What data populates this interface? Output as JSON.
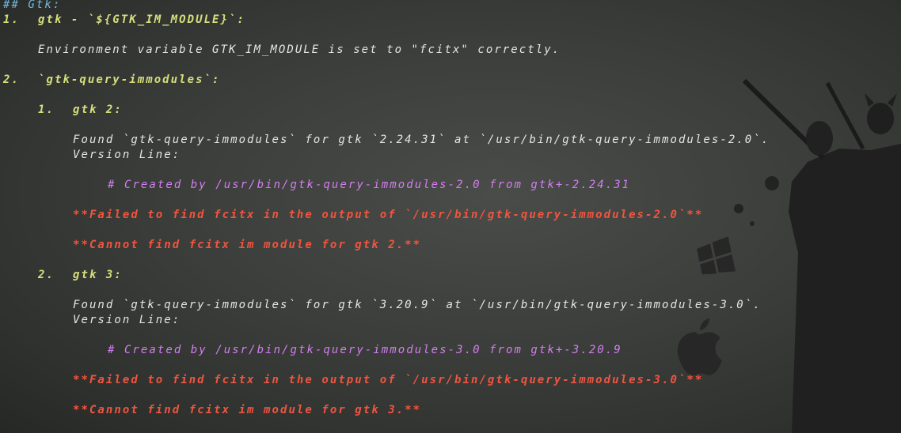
{
  "terminal": {
    "heading": "## Gtk:",
    "item1_num": "1.",
    "item1_title": "gtk - `${GTK_IM_MODULE}`:",
    "item1_env": "Environment variable GTK_IM_MODULE is set to \"fcitx\" correctly.",
    "item2_num": "2.",
    "item2_title": "`gtk-query-immodules`:",
    "sub1_num": "1.",
    "sub1_title": "gtk 2:",
    "sub1_found": "Found `gtk-query-immodules` for gtk `2.24.31` at `/usr/bin/gtk-query-immodules-2.0`.",
    "sub1_version": "Version Line:",
    "sub1_created": "# Created by /usr/bin/gtk-query-immodules-2.0 from gtk+-2.24.31",
    "sub1_failed": "**Failed to find fcitx in the output of `/usr/bin/gtk-query-immodules-2.0`**",
    "sub1_cannot": "**Cannot find fcitx im module for gtk 2.**",
    "sub2_num": "2.",
    "sub2_title": "gtk 3:",
    "sub2_found": "Found `gtk-query-immodules` for gtk `3.20.9` at `/usr/bin/gtk-query-immodules-3.0`.",
    "sub2_version": "Version Line:",
    "sub2_created": "# Created by /usr/bin/gtk-query-immodules-3.0 from gtk+-3.20.9",
    "sub2_failed": "**Failed to find fcitx in the output of `/usr/bin/gtk-query-immodules-3.0`**",
    "sub2_cannot": "**Cannot find fcitx im module for gtk 3.**"
  },
  "colors": {
    "heading": "#74b8d9",
    "numbering": "#d7df7b",
    "text": "#e6e6e2",
    "comment": "#d37ef0",
    "error": "#f0553f"
  }
}
